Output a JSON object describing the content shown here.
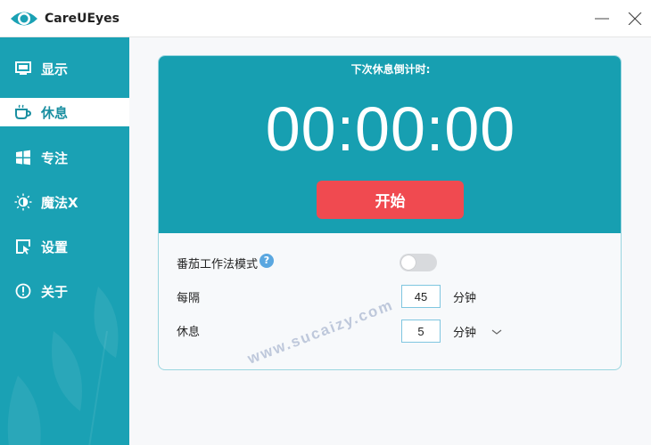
{
  "window": {
    "title": "CareUEyes",
    "logo_icon": "eye-icon",
    "accent": "#1aa1b4"
  },
  "sidebar": {
    "items": [
      {
        "label": "显示",
        "icon": "monitor-icon"
      },
      {
        "label": "休息",
        "icon": "coffee-cup-icon",
        "active": true
      },
      {
        "label": "专注",
        "icon": "windows-icon"
      },
      {
        "label": "魔法X",
        "icon": "sun-moon-icon"
      },
      {
        "label": "设置",
        "icon": "window-cursor-icon"
      },
      {
        "label": "关于",
        "icon": "info-icon"
      }
    ]
  },
  "timer": {
    "label": "下次休息倒计时:",
    "time": "00:00:00",
    "start_label": "开始",
    "start_color": "#f04a50"
  },
  "settings": {
    "pomodoro_label": "番茄工作法模式",
    "help_glyph": "?",
    "pomodoro_enabled": false,
    "interval_label": "每隔",
    "interval_value": "45",
    "interval_unit": "分钟",
    "rest_label": "休息",
    "rest_value": "5",
    "rest_unit": "分钟"
  },
  "watermark": "www.sucaizy.com"
}
